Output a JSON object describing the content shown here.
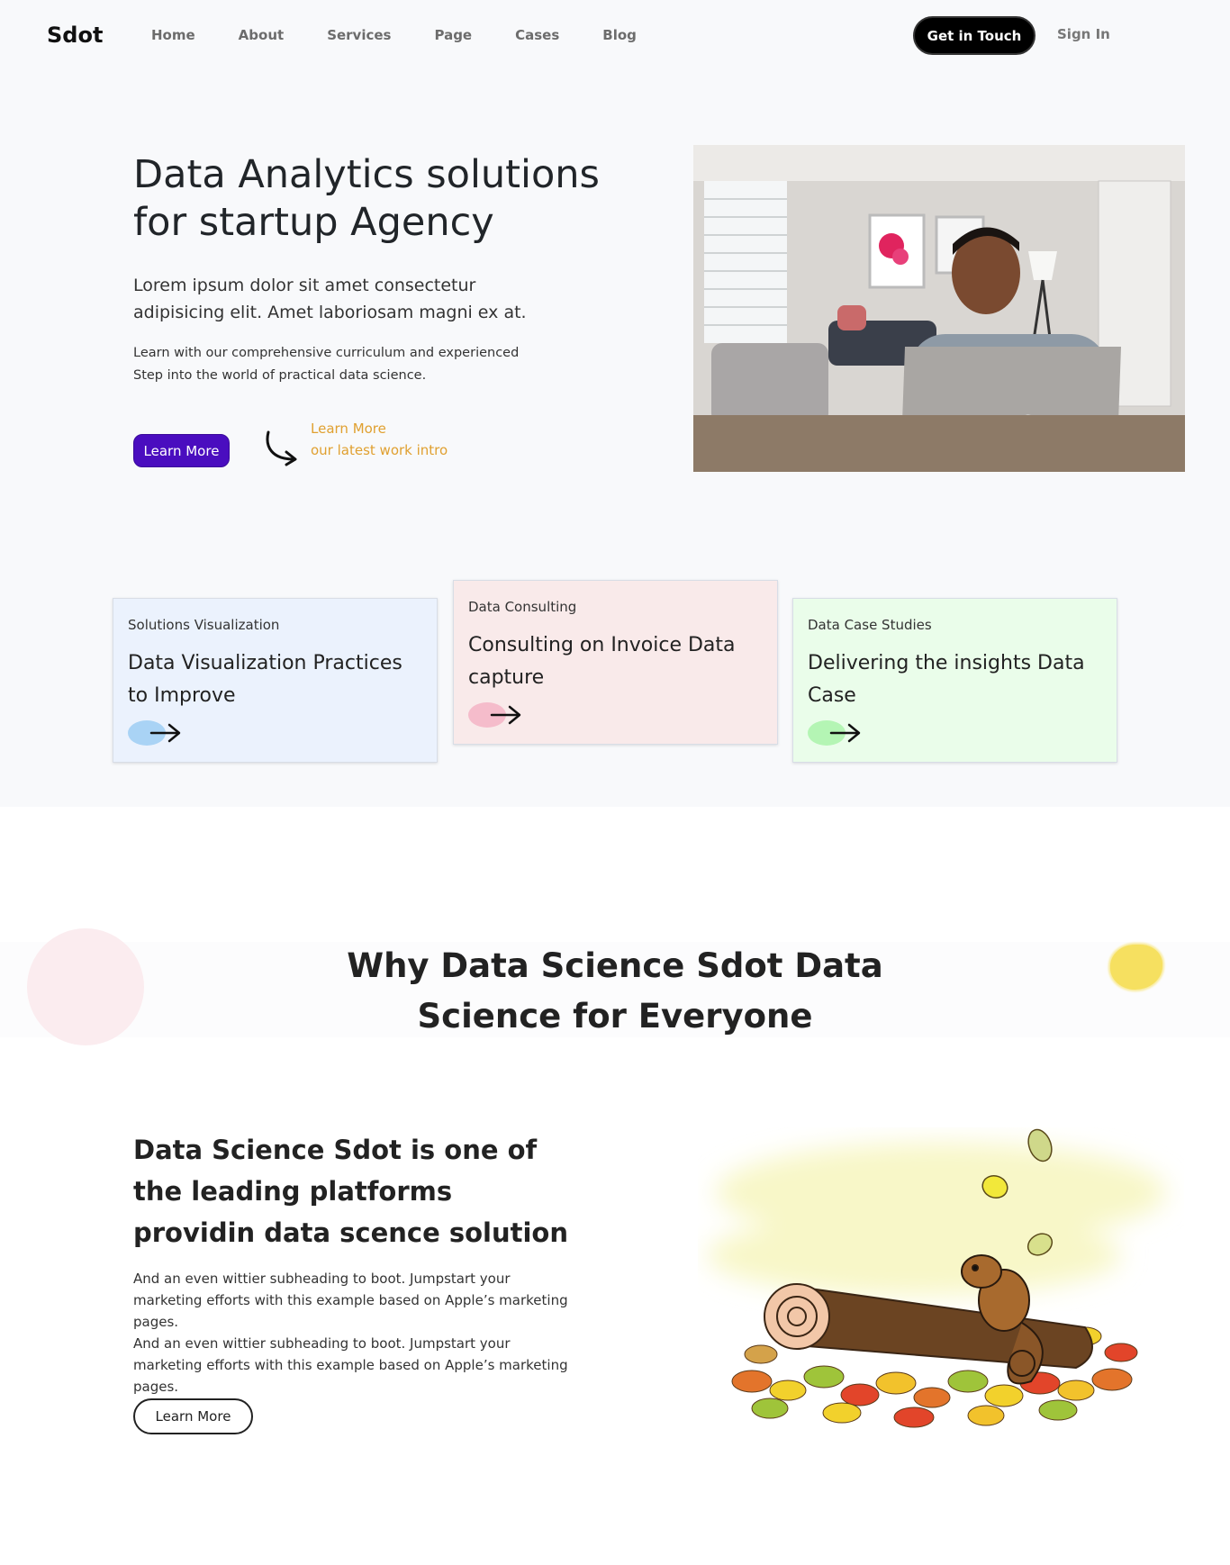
{
  "nav": {
    "logo": "Sdot",
    "links": [
      "Home",
      "About",
      "Services",
      "Page",
      "Cases",
      "Blog"
    ],
    "cta": "Get in Touch",
    "signin": "Sign In"
  },
  "hero": {
    "title": "Data Analytics solutions for startup Agency",
    "lead": "Lorem ipsum dolor sit amet consectetur adipisicing elit. Amet laboriosam magni ex at.",
    "small": "Learn with our comprehensive curriculum and experienced Step into the world of practical data science.",
    "button": "Learn More",
    "link_line1": "Learn More",
    "link_line2": "our latest work intro"
  },
  "cards": [
    {
      "category": "Solutions Visualization",
      "title": "Data Visualization Practices to Improve",
      "blob_color": "#a9d3f5"
    },
    {
      "category": "Data Consulting",
      "title": "Consulting on Invoice Data capture",
      "blob_color": "#f5bccb"
    },
    {
      "category": "Data Case Studies",
      "title": "Delivering the insights Data Case",
      "blob_color": "#b4f5b4"
    }
  ],
  "why": {
    "title": "Why Data Science Sdot Data Science for Everyone"
  },
  "about": {
    "title": "Data Science Sdot is one of the leading platforms providin data scence solution",
    "p1": "And an even wittier subheading to boot. Jumpstart your marketing efforts with this example based on Apple’s marketing pages.",
    "p2": "And an even wittier subheading to boot. Jumpstart your marketing efforts with this example based on Apple’s marketing pages.",
    "button": "Learn More"
  },
  "colors": {
    "accent_purple": "#4a0dbf",
    "link_orange": "#e0a030",
    "nav_bg": "#f8f9fb"
  }
}
